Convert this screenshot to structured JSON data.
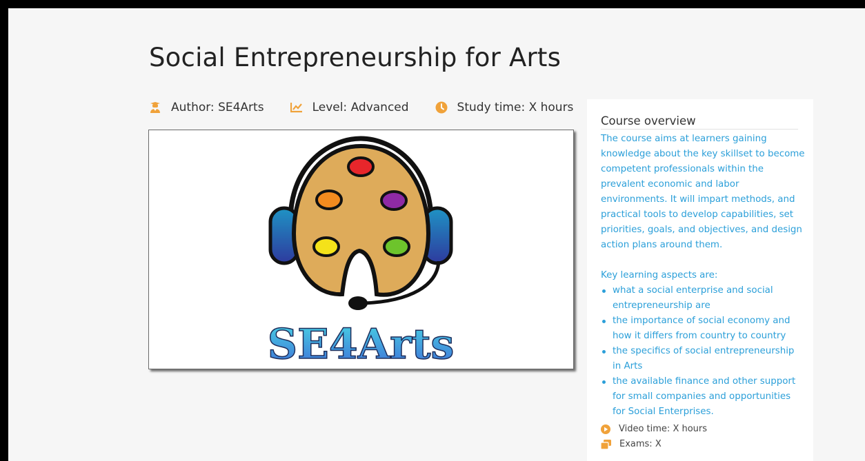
{
  "page": {
    "title": "Social Entrepreneurship for Arts"
  },
  "meta": {
    "author": "Author: SE4Arts",
    "level": "Level: Advanced",
    "study_time": "Study time: X hours"
  },
  "course_image": {
    "logo_text": "SE4Arts"
  },
  "overview": {
    "heading": "Course overview",
    "description": "The course aims at learners gaining knowledge about the key skillset to become competent professionals within the prevalent economic and labor environments. It will impart methods, and practical tools to develop capabilities, set priorities, goals, and objectives, and design action plans around them.",
    "aspects_heading": "Key learning aspects are:",
    "aspects": [
      "what a social enterprise and social entrepreneurship are",
      "the importance of social economy and how it differs from country to country",
      "the specifics of social entrepreneurship in Arts",
      "the available finance and other support for small companies and opportunities for Social Enterprises."
    ],
    "video_time": "Video time: X hours",
    "exams": "Exams: X"
  },
  "colors": {
    "accent_orange": "#f0a23a",
    "link_blue": "#2b9fd9"
  },
  "icons": {
    "author": "graduate-icon",
    "level": "chart-line-icon",
    "study_time": "clock-icon",
    "video_time": "play-circle-icon",
    "exams": "copy-icon"
  }
}
